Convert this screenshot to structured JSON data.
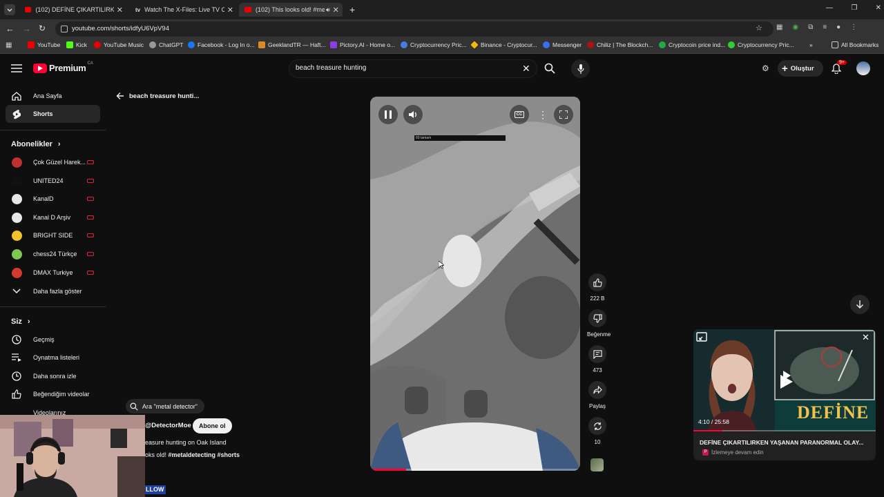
{
  "browser": {
    "tabs": [
      {
        "title": "(102) DEFİNE ÇIKARTILIRKEN YA"
      },
      {
        "title": "Watch The X-Files: Live TV Chan"
      },
      {
        "title": "(102) This looks old! #meta"
      }
    ],
    "url": "youtube.com/shorts/idfyU6VpV94",
    "bookmarks": [
      "YouTube",
      "Kick",
      "YouTube Music",
      "ChatGPT",
      "Facebook - Log In o...",
      "GeeklandTR — Haft...",
      "Pictory.AI - Home o...",
      "Cryptocurrency Pric...",
      "Binance - Cryptocur...",
      "Messenger",
      "Chiliz | The Blockch...",
      "Cryptocoin price ind...",
      "Cryptocurrency Pric..."
    ],
    "all_bookmarks": "All Bookmarks"
  },
  "header": {
    "logo": "Premium",
    "logo_region": "CA",
    "search_value": "beach treasure hunting",
    "create_label": "Oluştur",
    "notif_badge": "9+"
  },
  "sidebar": {
    "home": "Ana Sayfa",
    "shorts": "Shorts",
    "subs_title": "Abonelikler",
    "subs": [
      {
        "name": "Çok Güzel Harek...",
        "color": "#c03030"
      },
      {
        "name": "UNITED24",
        "color": "#111111"
      },
      {
        "name": "KanalD",
        "color": "#e8e8e8"
      },
      {
        "name": "Kanal D Arşiv",
        "color": "#e8e8e8"
      },
      {
        "name": "BRIGHT SIDE",
        "color": "#f2c12e"
      },
      {
        "name": "chess24 Türkçe",
        "color": "#7ec850"
      },
      {
        "name": "DMAX Turkiye",
        "color": "#d43a2a"
      }
    ],
    "more": "Daha fazla göster",
    "you_title": "Siz",
    "you_items": [
      "Geçmiş",
      "Oynatma listeleri",
      "Daha sonra izle",
      "Beğendiğim videolar",
      "Videolarınız"
    ]
  },
  "shorts": {
    "back_title": "beach treasure hunti...",
    "search_chip": "Ara \"metal detector\"",
    "channel": "@DetectorMoe",
    "subscribe": "Abone ol",
    "desc_line1": "easure hunting on Oak Island",
    "desc_line2_prefix": "oks old! ",
    "desc_line2_tags": "#metaldetecting #shorts",
    "overlay_text": "60 tamam",
    "like_count": "222 B",
    "dislike_label": "Beğenme",
    "comment_count": "473",
    "share_label": "Paylaş",
    "remix_count": "10",
    "progress": 0.17
  },
  "miniplayer": {
    "time": "4:10 / 25:58",
    "title": "DEFİNE ÇIKARTILIRKEN YAŞANAN PARANORMAL OLAY...",
    "subtitle": "İzlemeye devam edin",
    "thumb_text": "DEFİNE",
    "progress": 0.16
  },
  "webcam": {
    "follow_text": "LLOW"
  },
  "colors": {
    "yt_red": "#ff0033",
    "bg": "#0f0f0f",
    "chip": "#272727"
  }
}
